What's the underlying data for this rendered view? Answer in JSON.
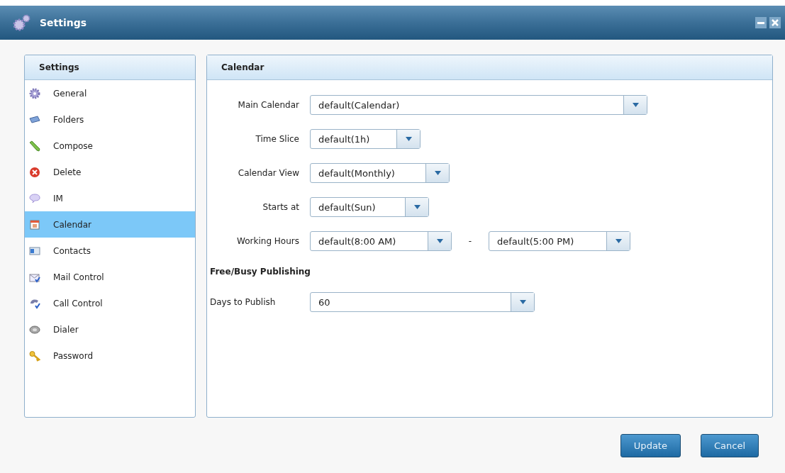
{
  "window": {
    "title": "Settings"
  },
  "sidebar": {
    "title": "Settings",
    "items": [
      {
        "label": "General",
        "selected": false
      },
      {
        "label": "Folders",
        "selected": false
      },
      {
        "label": "Compose",
        "selected": false
      },
      {
        "label": "Delete",
        "selected": false
      },
      {
        "label": "IM",
        "selected": false
      },
      {
        "label": "Calendar",
        "selected": true
      },
      {
        "label": "Contacts",
        "selected": false
      },
      {
        "label": "Mail Control",
        "selected": false
      },
      {
        "label": "Call Control",
        "selected": false
      },
      {
        "label": "Dialer",
        "selected": false
      },
      {
        "label": "Password",
        "selected": false
      }
    ]
  },
  "panel": {
    "title": "Calendar",
    "rows": [
      {
        "kind": "select",
        "label": "Main Calendar",
        "value": "default(Calendar)"
      },
      {
        "kind": "select",
        "label": "Time Slice",
        "value": "default(1h)"
      },
      {
        "kind": "select",
        "label": "Calendar View",
        "value": "default(Monthly)"
      },
      {
        "kind": "select",
        "label": "Starts at",
        "value": "default(Sun)"
      },
      {
        "kind": "range",
        "label": "Working Hours",
        "value": "default(8:00 AM)",
        "separator": "-",
        "value_2": "default(5:00 PM)"
      },
      {
        "kind": "heading",
        "label": "Free/Busy Publishing"
      },
      {
        "kind": "select",
        "label": "Days to Publish",
        "value": "60"
      }
    ]
  },
  "buttons": [
    "Update",
    "Cancel"
  ]
}
